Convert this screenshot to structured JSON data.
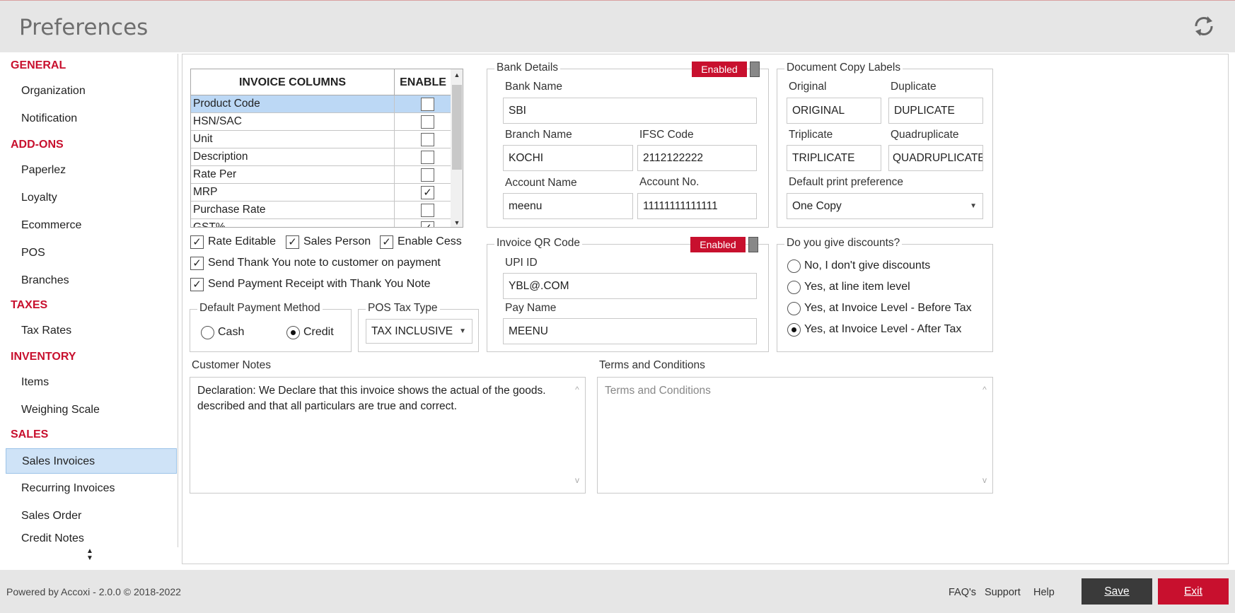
{
  "header": {
    "title": "Preferences",
    "refresh_icon": "refresh-icon"
  },
  "sidebar": {
    "groups": [
      {
        "label": "GENERAL",
        "items": [
          "Organization",
          "Notification"
        ]
      },
      {
        "label": "ADD-ONS",
        "items": [
          "Paperlez",
          "Loyalty",
          "Ecommerce",
          "POS",
          "Branches"
        ]
      },
      {
        "label": "TAXES",
        "items": [
          "Tax Rates"
        ]
      },
      {
        "label": "INVENTORY",
        "items": [
          "Items",
          "Weighing Scale"
        ]
      },
      {
        "label": "SALES",
        "items": [
          "Sales Invoices",
          "Recurring Invoices",
          "Sales Order",
          "Credit Notes"
        ]
      }
    ],
    "active_item": "Sales Invoices"
  },
  "invoice_columns": {
    "header_name": "INVOICE COLUMNS",
    "header_enable": "ENABLE",
    "rows": [
      {
        "name": "Product Code",
        "enabled": false,
        "selected": true
      },
      {
        "name": "HSN/SAC",
        "enabled": false
      },
      {
        "name": "Unit",
        "enabled": false
      },
      {
        "name": "Description",
        "enabled": false
      },
      {
        "name": "Rate Per",
        "enabled": false
      },
      {
        "name": "MRP",
        "enabled": true
      },
      {
        "name": "Purchase Rate",
        "enabled": false
      },
      {
        "name": "GST%",
        "enabled": true
      }
    ]
  },
  "options": {
    "rate_editable": {
      "label": "Rate Editable",
      "checked": true
    },
    "sales_person": {
      "label": "Sales Person",
      "checked": true
    },
    "enable_cess": {
      "label": "Enable Cess",
      "checked": true
    },
    "thank_you": {
      "label": "Send Thank You note to customer on payment",
      "checked": true
    },
    "payment_receipt": {
      "label": "Send Payment Receipt with Thank You Note",
      "checked": true
    }
  },
  "payment_method": {
    "legend": "Default Payment Method",
    "cash": "Cash",
    "credit": "Credit",
    "selected": "Credit"
  },
  "pos_tax": {
    "legend": "POS Tax Type",
    "value": "TAX INCLUSIVE"
  },
  "bank": {
    "legend": "Bank Details",
    "status": "Enabled",
    "bank_name_label": "Bank Name",
    "bank_name": "SBI",
    "branch_label": "Branch Name",
    "branch": "KOCHI",
    "ifsc_label": "IFSC Code",
    "ifsc": "2112122222",
    "account_name_label": "Account Name",
    "account_name": "meenu",
    "account_no_label": "Account No.",
    "account_no": "11111111111111"
  },
  "qr": {
    "legend": "Invoice QR Code",
    "status": "Enabled",
    "upi_label": "UPI ID",
    "upi": "YBL@.COM",
    "pay_name_label": "Pay Name",
    "pay_name": "MEENU"
  },
  "copy_labels": {
    "legend": "Document Copy Labels",
    "original_label": "Original",
    "original": "ORIGINAL",
    "duplicate_label": "Duplicate",
    "duplicate": "DUPLICATE",
    "triplicate_label": "Triplicate",
    "triplicate": "TRIPLICATE",
    "quadruplicate_label": "Quadruplicate",
    "quadruplicate": "QUADRUPLICATE",
    "print_pref_label": "Default print preference",
    "print_pref": "One Copy"
  },
  "discounts": {
    "legend": "Do you give discounts?",
    "options": [
      "No, I don't give discounts",
      "Yes, at line item level",
      "Yes, at Invoice Level - Before Tax",
      "Yes, at Invoice Level - After Tax"
    ],
    "selected_index": 3
  },
  "notes": {
    "customer_label": "Customer Notes",
    "customer_text": "Declaration: We Declare that this invoice shows the actual of the goods. described and that all particulars are true and correct.",
    "terms_label": "Terms and Conditions",
    "terms_placeholder": "Terms and Conditions"
  },
  "footer": {
    "powered": "Powered by Accoxi - 2.0.0 © 2018-2022",
    "faq": "FAQ's",
    "support": "Support",
    "help": "Help",
    "save": "Save",
    "exit": "Exit"
  },
  "colors": {
    "accent": "#c8102e",
    "selection": "#bcd8f5",
    "dark_button": "#3a3a3a"
  }
}
